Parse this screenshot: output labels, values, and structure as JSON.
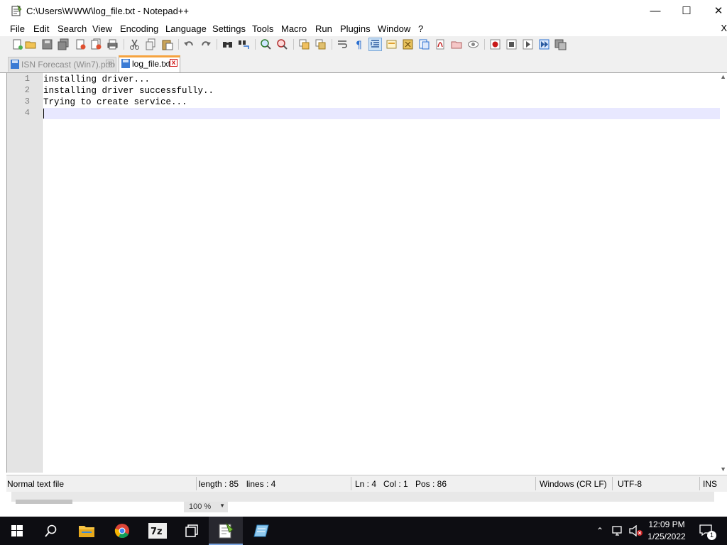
{
  "window": {
    "title": "C:\\Users\\WWW\\log_file.txt - Notepad++",
    "minimize_glyph": "—",
    "maximize_glyph": "☐",
    "close_glyph": "✕"
  },
  "menu": {
    "items": [
      "File",
      "Edit",
      "Search",
      "View",
      "Encoding",
      "Language",
      "Settings",
      "Tools",
      "Macro",
      "Run",
      "Plugins",
      "Window",
      "?"
    ],
    "close_glyph": "X"
  },
  "toolbar_icons": [
    "new-file",
    "open-file",
    "save",
    "save-all",
    "close",
    "close-all",
    "print",
    "cut",
    "copy",
    "paste",
    "undo",
    "redo",
    "find",
    "replace",
    "zoom-in",
    "zoom-out",
    "sync-vertical",
    "sync-horizontal",
    "word-wrap",
    "show-all-characters",
    "indent-guide",
    "user-defined-language",
    "document-map",
    "function-list",
    "folder-as-workspace",
    "monitoring",
    "start-recording",
    "stop-recording",
    "playback",
    "run-macro-multiple",
    "save-macro"
  ],
  "tabs": [
    {
      "label": "ISN Forecast (Win7).pdb",
      "active": false
    },
    {
      "label": "log_file.txt",
      "active": true
    }
  ],
  "tab_close_glyph": "x",
  "editor": {
    "lines": [
      {
        "number": "1",
        "text": "installing driver..."
      },
      {
        "number": "2",
        "text": "installing driver successfully.."
      },
      {
        "number": "3",
        "text": "Trying to create service..."
      },
      {
        "number": "4",
        "text": ""
      }
    ],
    "current_line": 4
  },
  "status": {
    "file_type": "Normal text file",
    "length": "length : 85",
    "lines": "lines : 4",
    "ln": "Ln : 4",
    "col": "Col : 1",
    "pos": "Pos : 86",
    "eol": "Windows (CR LF)",
    "encoding": "UTF-8",
    "mode": "INS"
  },
  "zoom": "100 %",
  "taskbar": {
    "apps": [
      "start",
      "search",
      "file-explorer",
      "chrome",
      "7-zip",
      "task-view",
      "notepad-plus-plus",
      "notepad"
    ],
    "time": "12:09 PM",
    "date": "1/25/2022",
    "notification_count": "1"
  },
  "colors": {
    "current_line": "#e8e8ff",
    "active_tab_accent": "#f6a33e",
    "taskbar": "#0d0d12"
  }
}
